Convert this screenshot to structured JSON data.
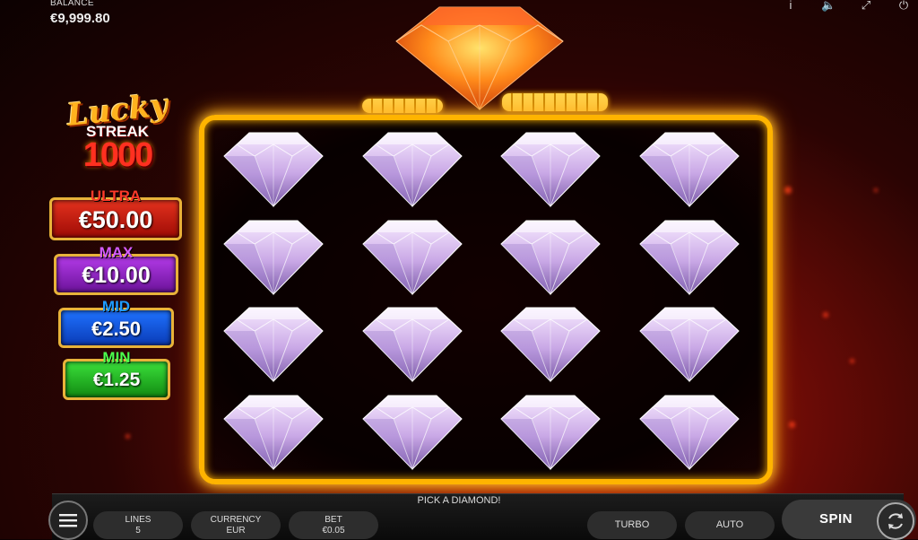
{
  "balance": {
    "label": "BALANCE",
    "value": "€9,999.80"
  },
  "top_icons": [
    "info-icon",
    "sound-icon",
    "fullscreen-icon",
    "power-icon"
  ],
  "logo": {
    "line1": "Lucky",
    "line2": "STREAK",
    "line3": "1000"
  },
  "jackpots": {
    "ultra": {
      "label": "ULTRA",
      "value": "€50.00"
    },
    "max": {
      "label": "MAX",
      "value": "€10.00"
    },
    "mid": {
      "label": "MID",
      "value": "€2.50"
    },
    "min": {
      "label": "MIN",
      "value": "€1.25"
    }
  },
  "board": {
    "rows": 4,
    "cols": 4,
    "tile": "diamond"
  },
  "message": "PICK A DIAMOND!",
  "bottom": {
    "lines": {
      "label": "LINES",
      "value": "5"
    },
    "currency": {
      "label": "CURRENCY",
      "value": "EUR"
    },
    "bet": {
      "label": "BET",
      "value": "€0.05"
    },
    "turbo": "TURBO",
    "auto": "AUTO",
    "spin": "SPIN"
  },
  "colors": {
    "board_border": "#ffb400",
    "ultra": "#c8200f",
    "max": "#8a22c4",
    "mid": "#1450d8",
    "min": "#1fa91f"
  }
}
